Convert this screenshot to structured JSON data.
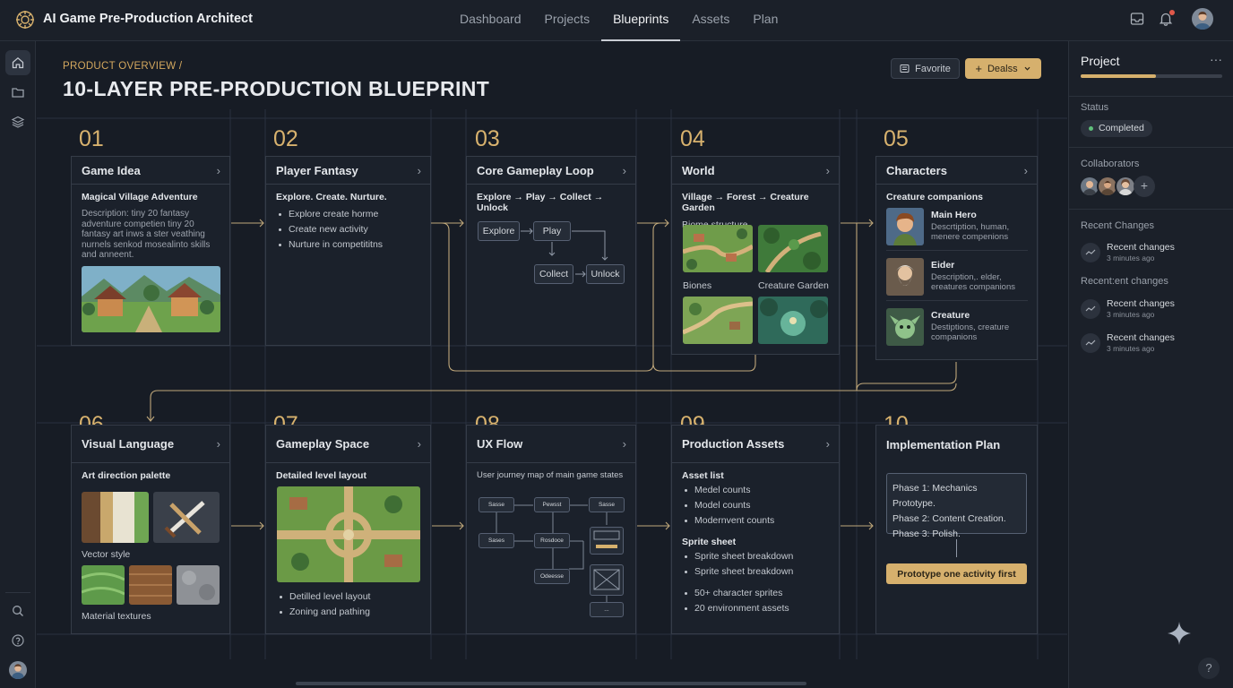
{
  "app": {
    "title": "AI Game Pre-Production Architect"
  },
  "nav": [
    {
      "label": "Dashboard"
    },
    {
      "label": "Projects"
    },
    {
      "label": "Blueprints",
      "active": true
    },
    {
      "label": "Assets"
    },
    {
      "label": "Plan"
    }
  ],
  "header": {
    "breadcrumb": "PRODUCT OVERVIEW /",
    "title": "10-LAYER PRE-PRODUCTION BLUEPRINT",
    "favorite_label": "Favorite",
    "deals_label": "Dealss"
  },
  "cards": {
    "c01": {
      "num": "01",
      "title": "Game Idea",
      "subtitle": "Magical Village Adventure",
      "desc": "Description: tiny 20 fantasy adventure competien tiny 20 fantasy art inws a ster veathing nurnels senkod mosealinto skills and anneent."
    },
    "c02": {
      "num": "02",
      "title": "Player Fantasy",
      "subtitle": "Explore. Create. Nurture.",
      "items": [
        "Explore create horme",
        "Create new activity",
        "Nurture in competititns"
      ]
    },
    "c03": {
      "num": "03",
      "title": "Core Gameplay Loop",
      "subtitle": "Explore → Play → Collect → Unlock",
      "loop": {
        "explore": "Explore",
        "play": "Play",
        "collect": "Collect",
        "unlock": "Unlock"
      }
    },
    "c04": {
      "num": "04",
      "title": "World",
      "subtitle": "Village → Forest → Creature Garden",
      "biome_label": "Biome structure",
      "cap_left": "Biones",
      "cap_right": "Creature Garden"
    },
    "c05": {
      "num": "05",
      "title": "Characters",
      "subtitle": "Creature companions",
      "chars": [
        {
          "name": "Main Hero",
          "desc": "Descrtiption, human, menere compenions"
        },
        {
          "name": "Eider",
          "desc": "Description,. elder, ereatures companions"
        },
        {
          "name": "Creature",
          "desc": "Destiptions, creature companions"
        }
      ]
    },
    "c06": {
      "num": "06",
      "title": "Visual Language",
      "subtitle": "Art direction palette",
      "vector_label": "Vector style",
      "material_label": "Material textures"
    },
    "c07": {
      "num": "07",
      "title": "Gameplay Space",
      "subtitle": "Detailed level layout",
      "items": [
        "Detilled level layout",
        "Zoning and pathing"
      ]
    },
    "c08": {
      "num": "08",
      "title": "UX Flow",
      "subtitle": "User journey map of main game states",
      "nodes": [
        "Sasse",
        "Pewsst",
        "Sasse",
        "Sases",
        "Rosdoce",
        "Odeesse",
        "..."
      ]
    },
    "c09": {
      "num": "09",
      "title": "Production Assets",
      "asset_head": "Asset list",
      "asset_items": [
        "Medel counts",
        "Model counts",
        "Modernvent counts"
      ],
      "sprite_head": "Sprite sheet",
      "sprite_items": [
        "Sprite sheet breakdown",
        "Sprite sheet breakdown"
      ],
      "count_items": [
        "50+ character sprites",
        "20 environment assets"
      ]
    },
    "c10": {
      "num": "10",
      "title": "Implementation Plan",
      "phases": [
        "Phase 1: Mechanics Prototype.",
        "Phase 2: Content Creation.",
        "Phase 3: Polish."
      ],
      "cta": "Prototype one activity first"
    }
  },
  "panel": {
    "title": "Project",
    "progress": 0.53,
    "status_label": "Status",
    "status": "Completed",
    "collab_label": "Collaborators",
    "recent_label": "Recent Changes",
    "recent_label2": "Recent:ent changes",
    "changes": [
      {
        "title": "Recent changes",
        "time": "3 minutes ago"
      },
      {
        "title": "Recent changes",
        "time": "3 minutes ago"
      },
      {
        "title": "Recent changes",
        "time": "3 minutes ago"
      }
    ]
  },
  "colors": {
    "accent": "#d6b06d",
    "background": "#171c25",
    "card": "#1b212b",
    "status_ok": "#5fbf7a"
  }
}
